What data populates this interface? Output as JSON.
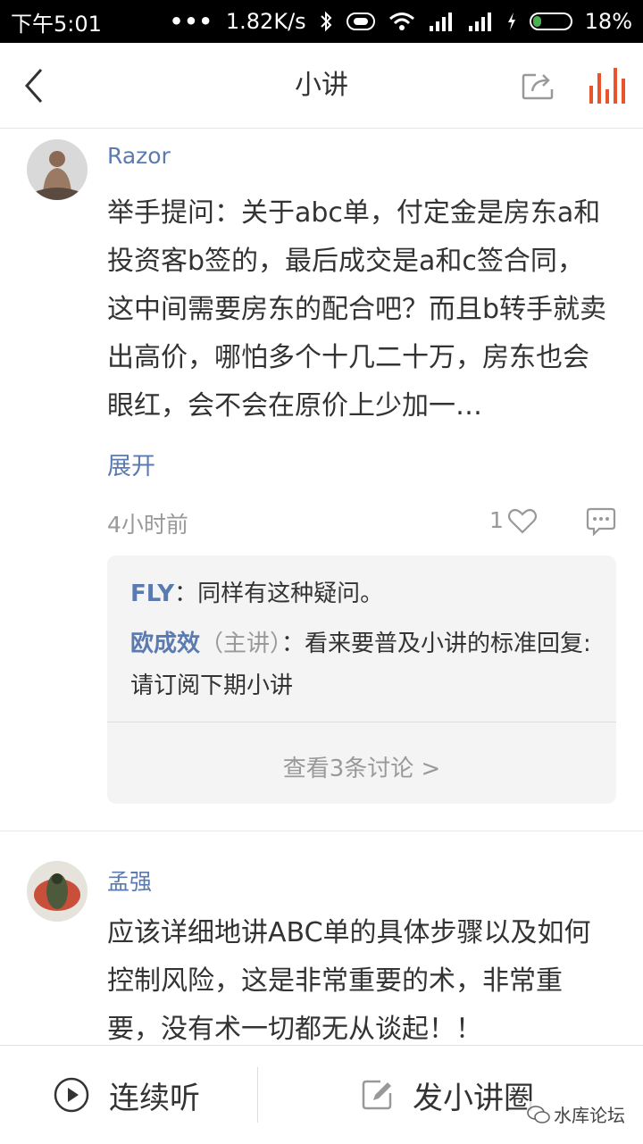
{
  "status_bar": {
    "time": "下午5:01",
    "dots": "•••",
    "speed": "1.82K/s",
    "battery": "18%"
  },
  "nav": {
    "title": "小讲"
  },
  "colors": {
    "accent_red": "#e8542c",
    "link_blue": "#5b7bb0",
    "battery_green": "#4caf50"
  },
  "posts": [
    {
      "author": "Razor",
      "content": "举手提问：关于abc单，付定金是房东a和投资客b签的，最后成交是a和c签合同，这中间需要房东的配合吧？而且b转手就卖出高价，哪怕多个十几二十万，房东也会眼红，会不会在原价上少加一…",
      "expand": "展开",
      "time": "4小时前",
      "likes": "1",
      "replies": [
        {
          "name": "FLY",
          "role": "",
          "sep": "：",
          "text": "同样有这种疑问。"
        },
        {
          "name": "欧成效",
          "role": "（主讲）",
          "sep": "：",
          "text": "看来要普及小讲的标准回复: 请订阅下期小讲"
        }
      ],
      "view_more": "查看3条讨论 >"
    },
    {
      "author": "孟强",
      "content": "应该详细地讲ABC单的具体步骤以及如何控制风险，这是非常重要的术，非常重要，没有术一切都无从谈起！！"
    }
  ],
  "bottom_bar": {
    "continuous_listen": "连续听",
    "post_circle": "发小讲圈"
  },
  "watermark": "水库论坛"
}
